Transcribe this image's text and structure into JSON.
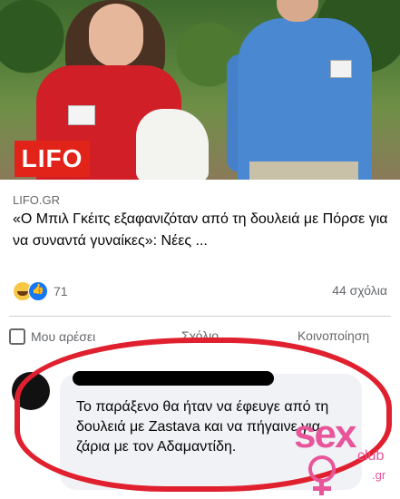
{
  "post": {
    "image_logo": "LIFO",
    "source": "LIFO.GR",
    "headline": "«Ο Μπιλ Γκέιτς εξαφανιζόταν από τη δουλειά με Πόρσε για να συναντά γυναίκες»: Νέες ...",
    "reaction_count": "71",
    "comments_count": "44 σχόλια"
  },
  "actions": {
    "like": "Μου αρέσει",
    "comment": "Σχόλιο",
    "share": "Κοινοποίηση"
  },
  "comment": {
    "text": "Το παράξενο θα ήταν να έφευγε από τη δουλειά με Zastava και να πήγαινε για ζάρια με τον Αδαμαντίδη."
  },
  "watermark": {
    "main": "sex",
    "sub": "club",
    "domain": ".gr"
  },
  "colors": {
    "annotation_circle": "#e0202e",
    "logo_bg": "#e2231a",
    "link_blue": "#1877f2"
  },
  "icons": [
    "haha-reaction-icon",
    "like-reaction-icon",
    "thumbs-up-icon"
  ]
}
